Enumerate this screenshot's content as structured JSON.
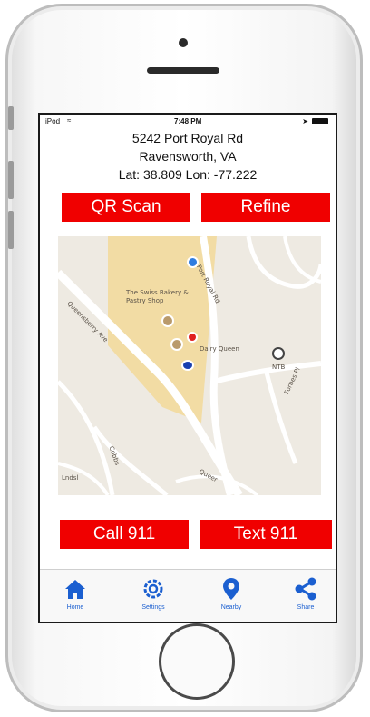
{
  "status_bar": {
    "carrier": "iPod",
    "time": "7:48 PM"
  },
  "location": {
    "street": "5242 Port Royal Rd",
    "city": "Ravensworth, VA",
    "coords": "Lat: 38.809  Lon: -77.222"
  },
  "actions": {
    "qr_scan": "QR Scan",
    "refine": "Refine",
    "call": "Call 911",
    "text": "Text 911"
  },
  "map": {
    "poi_swiss_bakery": "The Swiss Bakery & Pastry Shop",
    "poi_dairy_queen": "Dairy Queen",
    "poi_ntb": "NTB",
    "road_port_royal": "Port Royal Rd",
    "road_queensberry": "Queensberry Ave",
    "road_forbes": "Forbes Pl",
    "road_cobbs": "Cobbs",
    "road_lindsey": "Lndsl",
    "road_queensberry_bottom": "Queer"
  },
  "tabs": [
    {
      "label": "Home",
      "icon": "home-icon"
    },
    {
      "label": "Settings",
      "icon": "gear-icon"
    },
    {
      "label": "Nearby",
      "icon": "location-pin-icon"
    },
    {
      "label": "Share",
      "icon": "share-icon"
    }
  ],
  "colors": {
    "action_red": "#f00000",
    "tab_blue": "#1b5fd0",
    "map_highlight": "#f2dca4"
  }
}
